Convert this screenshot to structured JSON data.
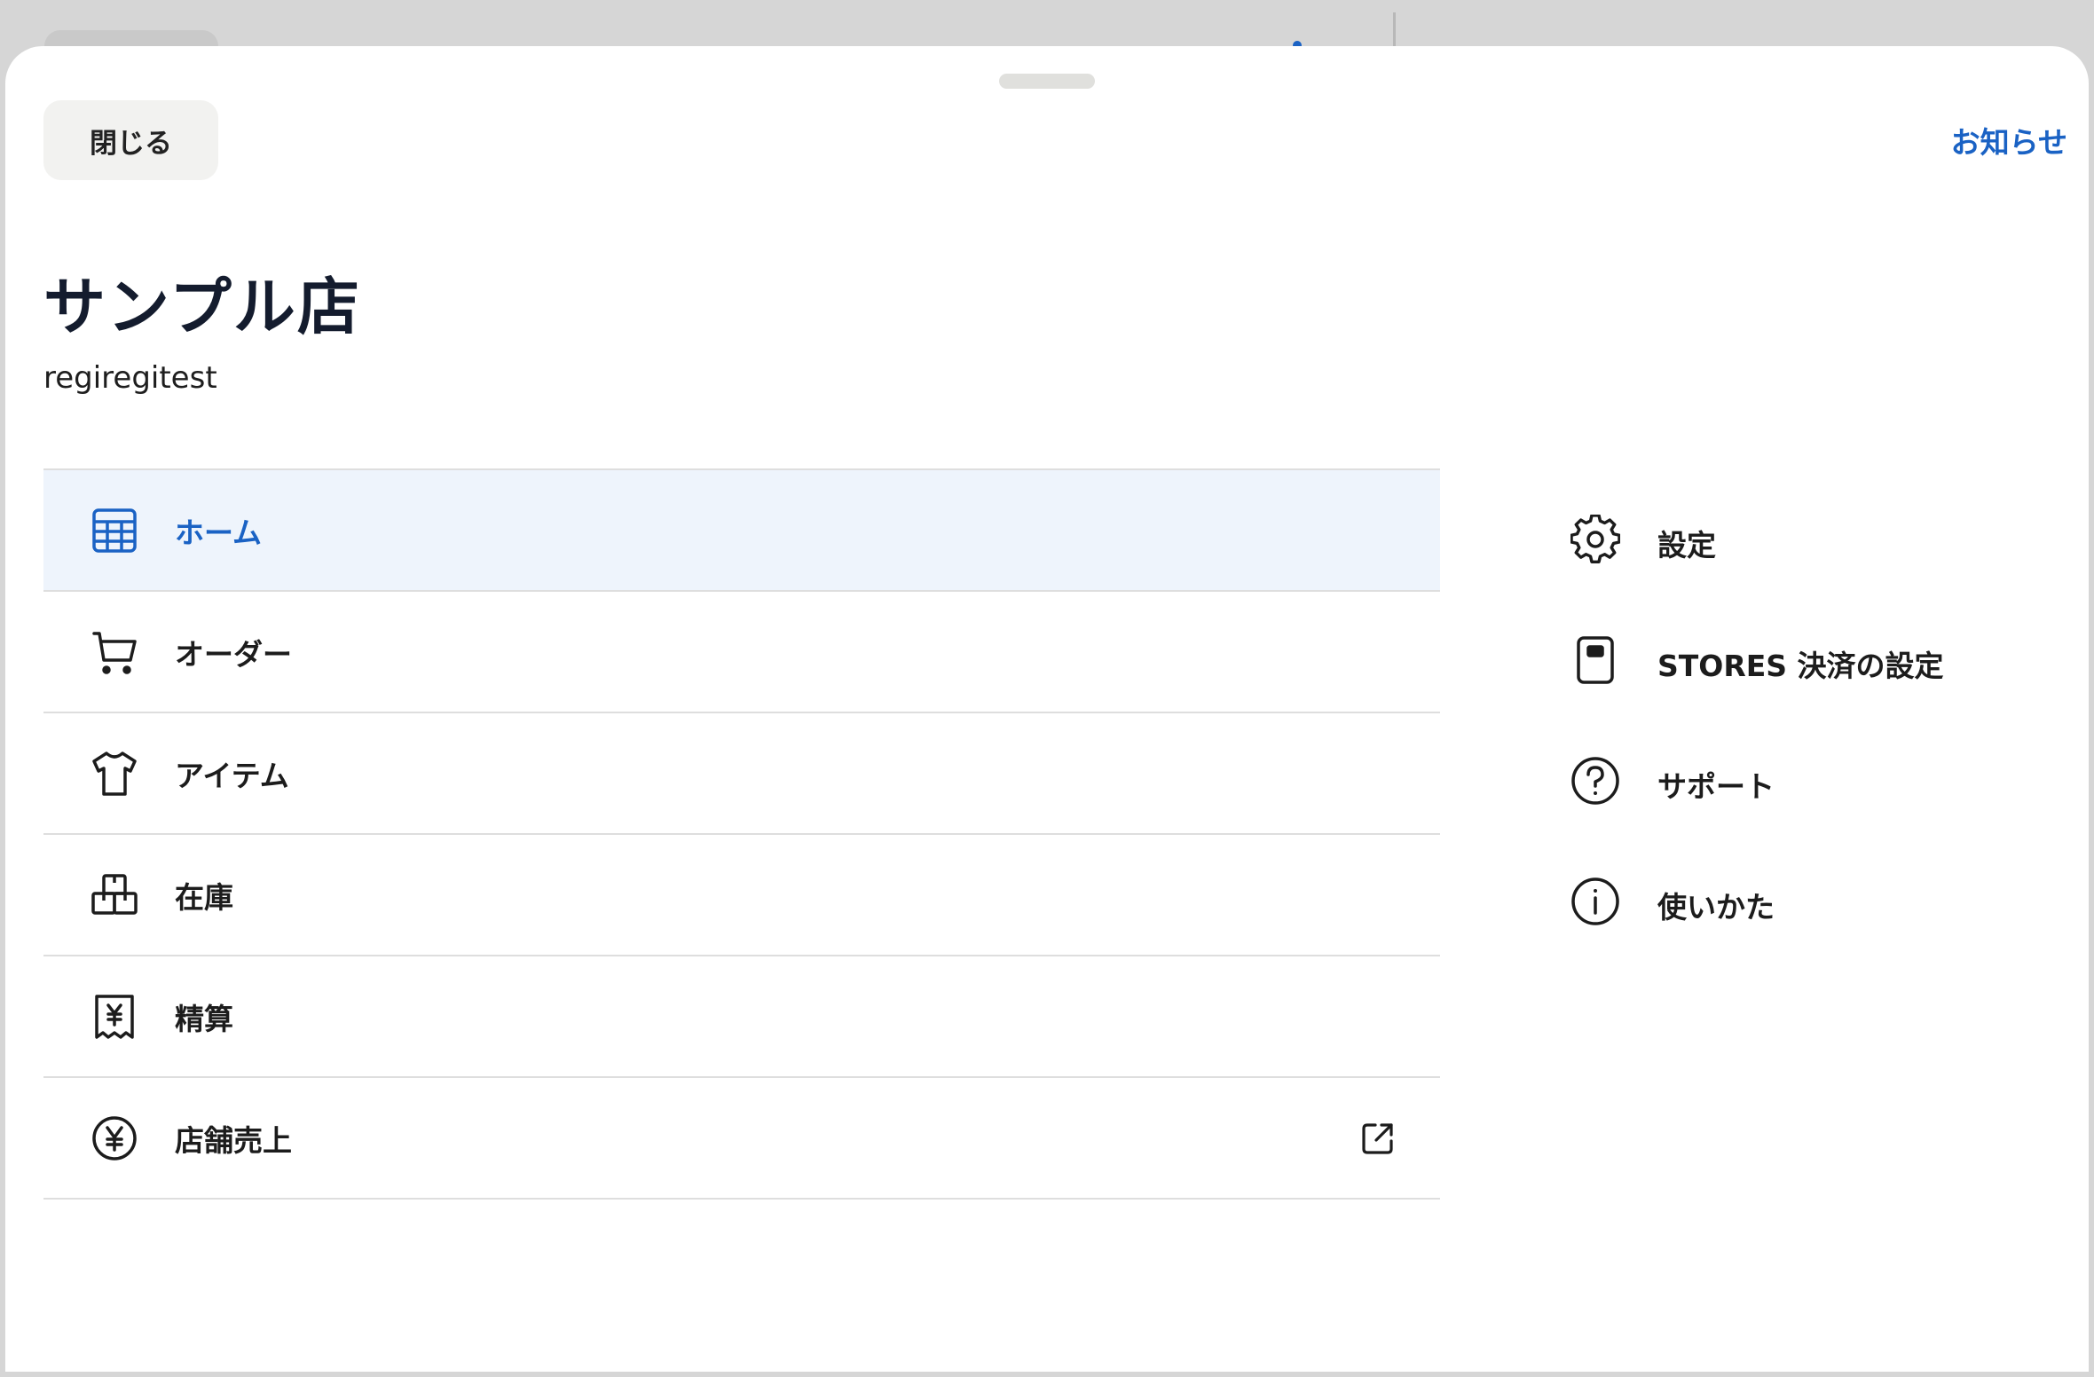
{
  "header": {
    "close_label": "閉じる",
    "notice_label": "お知らせ"
  },
  "store": {
    "name": "サンプル店",
    "id": "regiregitest"
  },
  "nav": {
    "items": [
      {
        "label": "ホーム",
        "icon": "grid-icon",
        "active": true
      },
      {
        "label": "オーダー",
        "icon": "cart-icon"
      },
      {
        "label": "アイテム",
        "icon": "tshirt-icon"
      },
      {
        "label": "在庫",
        "icon": "boxes-icon"
      },
      {
        "label": "精算",
        "icon": "receipt-yen-icon"
      },
      {
        "label": "店舗売上",
        "icon": "yen-circle-icon",
        "external": true
      }
    ]
  },
  "side": {
    "items": [
      {
        "label": "設定",
        "icon": "gear-icon"
      },
      {
        "label": "STORES 決済の設定",
        "icon": "card-reader-icon"
      },
      {
        "label": "サポート",
        "icon": "question-circle-icon"
      },
      {
        "label": "使いかた",
        "icon": "info-circle-icon"
      }
    ]
  },
  "colors": {
    "accent": "#1a62c4",
    "active_bg": "#eef4fc",
    "text": "#1c1c1c",
    "title": "#141c2e"
  }
}
